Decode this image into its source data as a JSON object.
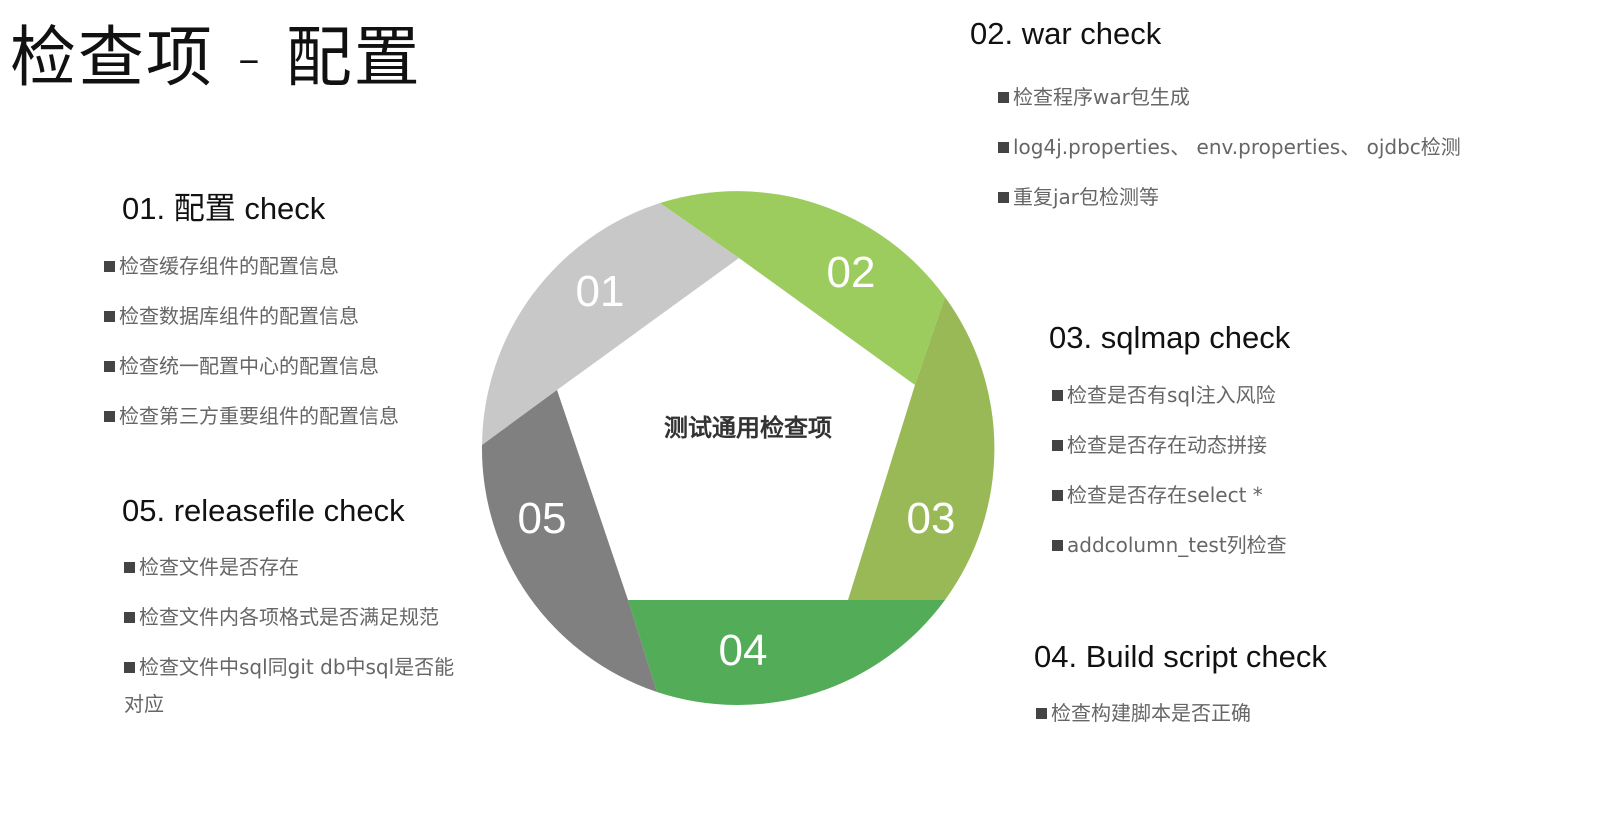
{
  "title": "检查项 - 配置",
  "center_label": "测试通用检查项",
  "segments": [
    {
      "label": "01",
      "color": "#c8c8c8"
    },
    {
      "label": "02",
      "color": "#9ccc5e"
    },
    {
      "label": "03",
      "color": "#99b957"
    },
    {
      "label": "04",
      "color": "#52ac58"
    },
    {
      "label": "05",
      "color": "#808080"
    }
  ],
  "sections": {
    "s01": {
      "heading": "01. 配置 check",
      "items": [
        "检查缓存组件的配置信息",
        "检查数据库组件的配置信息",
        "检查统一配置中心的配置信息",
        "检查第三方重要组件的配置信息"
      ]
    },
    "s02": {
      "heading": "02. war check",
      "items": [
        "检查程序war包生成",
        "log4j.properties、 env.properties、 ojdbc检测",
        "重复jar包检测等"
      ]
    },
    "s03": {
      "heading": "03. sqlmap check",
      "items": [
        "检查是否有sql注入风险",
        "检查是否存在动态拼接",
        "检查是否存在select *",
        "addcolumn_test列检查"
      ]
    },
    "s04": {
      "heading": "04. Build script check",
      "items": [
        "检查构建脚本是否正确"
      ]
    },
    "s05": {
      "heading": "05. releasefile check",
      "items": [
        "检查文件是否存在",
        "检查文件内各项格式是否满足规范",
        "检查文件中sql同git db中sql是否能对应"
      ]
    }
  }
}
